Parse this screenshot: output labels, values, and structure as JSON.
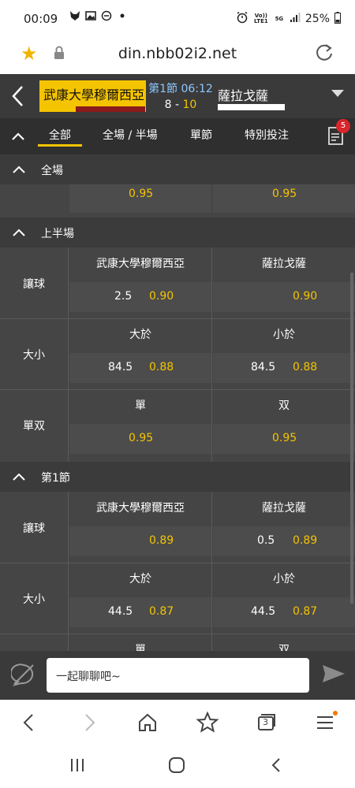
{
  "status_bar": {
    "time": "00:09",
    "battery": "25%",
    "network": "5G",
    "volte": "Vo)) LTE1"
  },
  "browser": {
    "url": "din.nbb02i2.net",
    "tab_count": "3"
  },
  "match": {
    "home_team": "武康大學穆爾西亞",
    "away_team": "薩拉戈薩",
    "period_clock": "第1節 06:12",
    "home_score": "8",
    "score_sep": " - ",
    "away_score": "10"
  },
  "tabs": [
    {
      "label": "全部"
    },
    {
      "label": "全場 / 半場"
    },
    {
      "label": "單節"
    },
    {
      "label": "特別投注"
    }
  ],
  "bet_slip_count": "5",
  "sections": {
    "full_game": {
      "title": "全場",
      "odds": [
        "0.95",
        "0.95"
      ]
    },
    "first_half": {
      "title": "上半場",
      "handicap": {
        "label": "讓球",
        "home": "武康大學穆爾西亞",
        "away": "薩拉戈薩",
        "home_line": "2.5",
        "home_price": "0.90",
        "away_line": "",
        "away_price": "0.90"
      },
      "total": {
        "label": "大小",
        "over": "大於",
        "under": "小於",
        "over_line": "84.5",
        "over_price": "0.88",
        "under_line": "84.5",
        "under_price": "0.88"
      },
      "odd_even": {
        "label": "單双",
        "odd": "單",
        "even": "双",
        "odd_price": "0.95",
        "even_price": "0.95"
      }
    },
    "q1": {
      "title": "第1節",
      "handicap": {
        "label": "讓球",
        "home": "武康大學穆爾西亞",
        "away": "薩拉戈薩",
        "home_line": "",
        "home_price": "0.89",
        "away_line": "0.5",
        "away_price": "0.89"
      },
      "total": {
        "label": "大小",
        "over": "大於",
        "under": "小於",
        "over_line": "44.5",
        "over_price": "0.87",
        "under_line": "44.5",
        "under_price": "0.87"
      },
      "odd_even": {
        "odd": "單",
        "even": "双"
      }
    }
  },
  "chat": {
    "placeholder": "一起聊聊吧~"
  }
}
